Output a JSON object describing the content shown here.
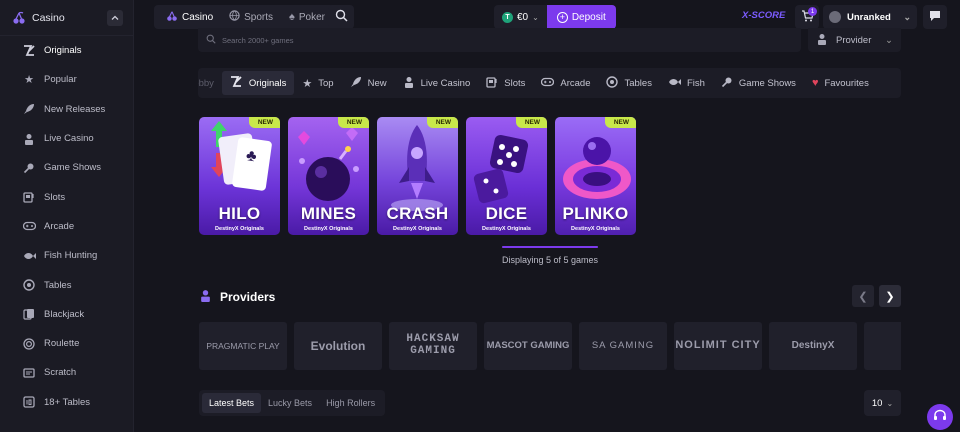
{
  "sidebar": {
    "title": "Casino",
    "items": [
      {
        "label": "Originals",
        "icon": "originals-icon"
      },
      {
        "label": "Popular",
        "icon": "star-icon"
      },
      {
        "label": "New Releases",
        "icon": "rocket-icon"
      },
      {
        "label": "Live Casino",
        "icon": "dealer-icon"
      },
      {
        "label": "Game Shows",
        "icon": "microphone-icon"
      },
      {
        "label": "Slots",
        "icon": "slot-machine-icon"
      },
      {
        "label": "Arcade",
        "icon": "gamepad-icon"
      },
      {
        "label": "Fish Hunting",
        "icon": "fish-icon"
      },
      {
        "label": "Tables",
        "icon": "chips-icon"
      },
      {
        "label": "Blackjack",
        "icon": "cards-icon"
      },
      {
        "label": "Roulette",
        "icon": "roulette-icon"
      },
      {
        "label": "Scratch",
        "icon": "scratch-icon"
      },
      {
        "label": "18+ Tables",
        "icon": "adult-icon"
      }
    ]
  },
  "topbar": {
    "nav": [
      {
        "label": "Casino",
        "icon": "cherry-icon"
      },
      {
        "label": "Sports",
        "icon": "ball-icon"
      },
      {
        "label": "Poker",
        "icon": "spade-icon"
      }
    ],
    "balance": "€0",
    "balance_coin": "T",
    "deposit_label": "Deposit",
    "xscore_label": "X-SCORE",
    "cart_badge": "1",
    "rank_label": "Unranked"
  },
  "search": {
    "placeholder": "Search 2000+ games",
    "provider_label": "Provider"
  },
  "categories": [
    {
      "label": "Lobby",
      "icon": ""
    },
    {
      "label": "Originals",
      "icon": "originals-icon"
    },
    {
      "label": "Top",
      "icon": "star-icon"
    },
    {
      "label": "New",
      "icon": "rocket-icon"
    },
    {
      "label": "Live Casino",
      "icon": "dealer-icon"
    },
    {
      "label": "Slots",
      "icon": "slot-machine-icon"
    },
    {
      "label": "Arcade",
      "icon": "gamepad-icon"
    },
    {
      "label": "Tables",
      "icon": "chips-icon"
    },
    {
      "label": "Fish",
      "icon": "fish-icon"
    },
    {
      "label": "Game Shows",
      "icon": "microphone-icon"
    },
    {
      "label": "Favourites",
      "icon": "heart-icon"
    }
  ],
  "games": [
    {
      "name": "HILO",
      "subtitle": "DestinyX Originals",
      "badge": "NEW"
    },
    {
      "name": "MINES",
      "subtitle": "DestinyX Originals",
      "badge": "NEW"
    },
    {
      "name": "CRASH",
      "subtitle": "DestinyX Originals",
      "badge": "NEW"
    },
    {
      "name": "DICE",
      "subtitle": "DestinyX Originals",
      "badge": "NEW"
    },
    {
      "name": "PLINKO",
      "subtitle": "DestinyX Originals",
      "badge": "NEW"
    }
  ],
  "games_progress": 1.0,
  "displaying_text": "Displaying 5 of 5 games",
  "providers": {
    "title": "Providers",
    "list": [
      "PRAGMATIC PLAY",
      "Evolution",
      "HACKSAW GAMING",
      "MASCOT GAMING",
      "SA GAMING",
      "NOLIMIT CITY",
      "DestinyX",
      ""
    ]
  },
  "bets": {
    "tabs": [
      "Latest Bets",
      "Lucky Bets",
      "High Rollers"
    ],
    "page_size": "10"
  },
  "colors": {
    "accent": "#7c3aed",
    "badge": "#c8e84a",
    "background": "#15151d"
  }
}
